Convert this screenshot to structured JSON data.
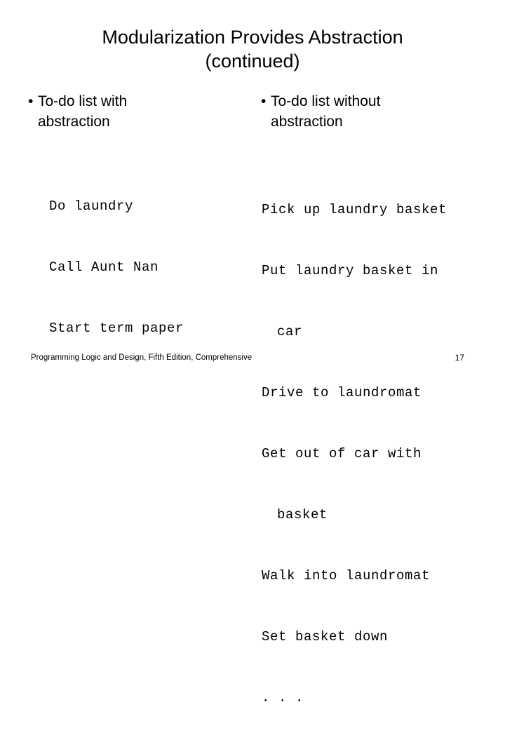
{
  "slide": {
    "title_lines": [
      "Modularization Provides Abstraction",
      "(continued)"
    ],
    "bullet_glyph": "•",
    "columns": [
      {
        "bullet": "To-do list with abstraction",
        "code_lines": [
          {
            "text": "Do laundry",
            "indent": false
          },
          {
            "text": "Call Aunt Nan",
            "indent": false
          },
          {
            "text": "Start term paper",
            "indent": false
          }
        ]
      },
      {
        "bullet": "To-do list without abstraction",
        "code_lines": [
          {
            "text": "Pick up laundry basket",
            "indent": false
          },
          {
            "text": "Put laundry basket in",
            "indent": false
          },
          {
            "text": "car",
            "indent": true
          },
          {
            "text": "Drive to laundromat",
            "indent": false
          },
          {
            "text": "Get out of car with",
            "indent": false
          },
          {
            "text": "basket",
            "indent": true
          },
          {
            "text": "Walk into laundromat",
            "indent": false
          },
          {
            "text": "Set basket down",
            "indent": false
          },
          {
            "text": ". . .",
            "indent": false
          }
        ]
      }
    ],
    "footer": {
      "text": "Programming Logic and Design, Fifth Edition, Comprehensive",
      "page_number": "17"
    }
  }
}
